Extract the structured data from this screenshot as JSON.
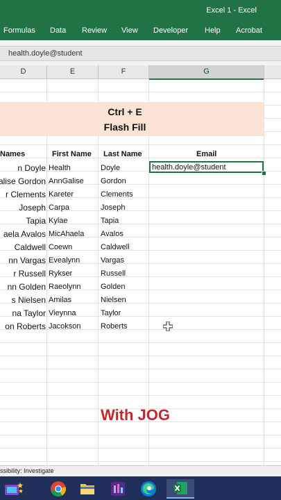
{
  "window": {
    "title": "Excel 1  -  Excel"
  },
  "ribbon": {
    "tabs": [
      "Formulas",
      "Data",
      "Review",
      "View",
      "Developer",
      "Help",
      "Acrobat"
    ]
  },
  "formula_bar": {
    "content": "health.doyle@student"
  },
  "columns": [
    "D",
    "E",
    "F",
    "G"
  ],
  "banner": {
    "line1": "Ctrl + E",
    "line2": "Flash Fill"
  },
  "table": {
    "headers": {
      "names": "Names",
      "first": "First Name",
      "last": "Last Name",
      "email": "Email"
    },
    "rows": [
      {
        "name": "n Doyle",
        "first": "Health",
        "last": "Doyle"
      },
      {
        "name": "alise Gordon",
        "first": "AnnGalise",
        "last": "Gordon"
      },
      {
        "name": "r Clements",
        "first": "Kareter",
        "last": "Clements"
      },
      {
        "name": "Joseph",
        "first": "Carpa",
        "last": "Joseph"
      },
      {
        "name": "Tapia",
        "first": "Kylae",
        "last": "Tapia"
      },
      {
        "name": "aela Avalos",
        "first": "MicAhaela",
        "last": "Avalos"
      },
      {
        "name": "Caldwell",
        "first": "Coewn",
        "last": "Caldwell"
      },
      {
        "name": "nn Vargas",
        "first": "Evealynn",
        "last": "Vargas"
      },
      {
        "name": "r Russell",
        "first": "Rykser",
        "last": "Russell"
      },
      {
        "name": "nn Golden",
        "first": "Raeolynn",
        "last": "Golden"
      },
      {
        "name": "s Nielsen",
        "first": "Amilas",
        "last": "Nielsen"
      },
      {
        "name": "na Taylor",
        "first": "Vieynna",
        "last": "Taylor"
      },
      {
        "name": "on Roberts",
        "first": "Jacokson",
        "last": "Roberts"
      }
    ],
    "email_first": "health.doyle@student"
  },
  "watermark": "With JOG",
  "statusbar": {
    "text": "ssibility: Investigate"
  },
  "taskbar": {
    "icons": [
      "tv-stars-icon",
      "chrome-icon",
      "file-explorer-icon",
      "app-icon",
      "edge-icon",
      "excel-icon"
    ]
  },
  "colors": {
    "excel_green": "#217346",
    "banner_bg": "#fbe4d5",
    "watermark": "#c0282e",
    "taskbar": "#20305a"
  }
}
